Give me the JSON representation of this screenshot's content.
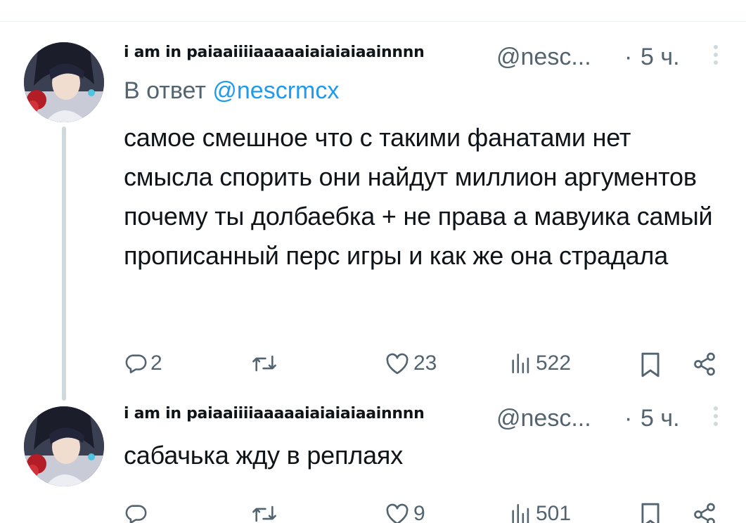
{
  "tweets": [
    {
      "display_name": "i am in paiaaiiiiaaaaaiaiaiaiaainnnn",
      "handle": "@nesc...",
      "separator": "·",
      "time": "5 ч.",
      "reply_prefix": "В ответ",
      "reply_mention": "@nescrmcx",
      "text": "самое смешное что с такими фанатами нет смысла спорить они найдут миллион аргументов почему ты долбаебка + не права а мавуика самый прописанный перс игры и как же она страдала",
      "replies": "2",
      "retweets": "",
      "likes": "23",
      "views": "522"
    },
    {
      "display_name": "i am in paiaaiiiiaaaaaiaiaiaiaainnnn",
      "handle": "@nesc...",
      "separator": "·",
      "time": "5 ч.",
      "text": "сабачька жду в реплаях",
      "replies": "",
      "retweets": "",
      "likes": "9",
      "views": "501"
    }
  ],
  "icons": {
    "reply": "speech-bubble-icon",
    "retweet": "retweet-arrows-icon",
    "like": "heart-icon",
    "views": "bar-chart-icon",
    "bookmark": "bookmark-icon",
    "share": "share-nodes-icon",
    "more": "vertical-dots-icon"
  },
  "colors": {
    "text": "#0f1419",
    "secondary": "#536471",
    "link": "#1d9bf0",
    "thread_line": "#cfd9de"
  }
}
